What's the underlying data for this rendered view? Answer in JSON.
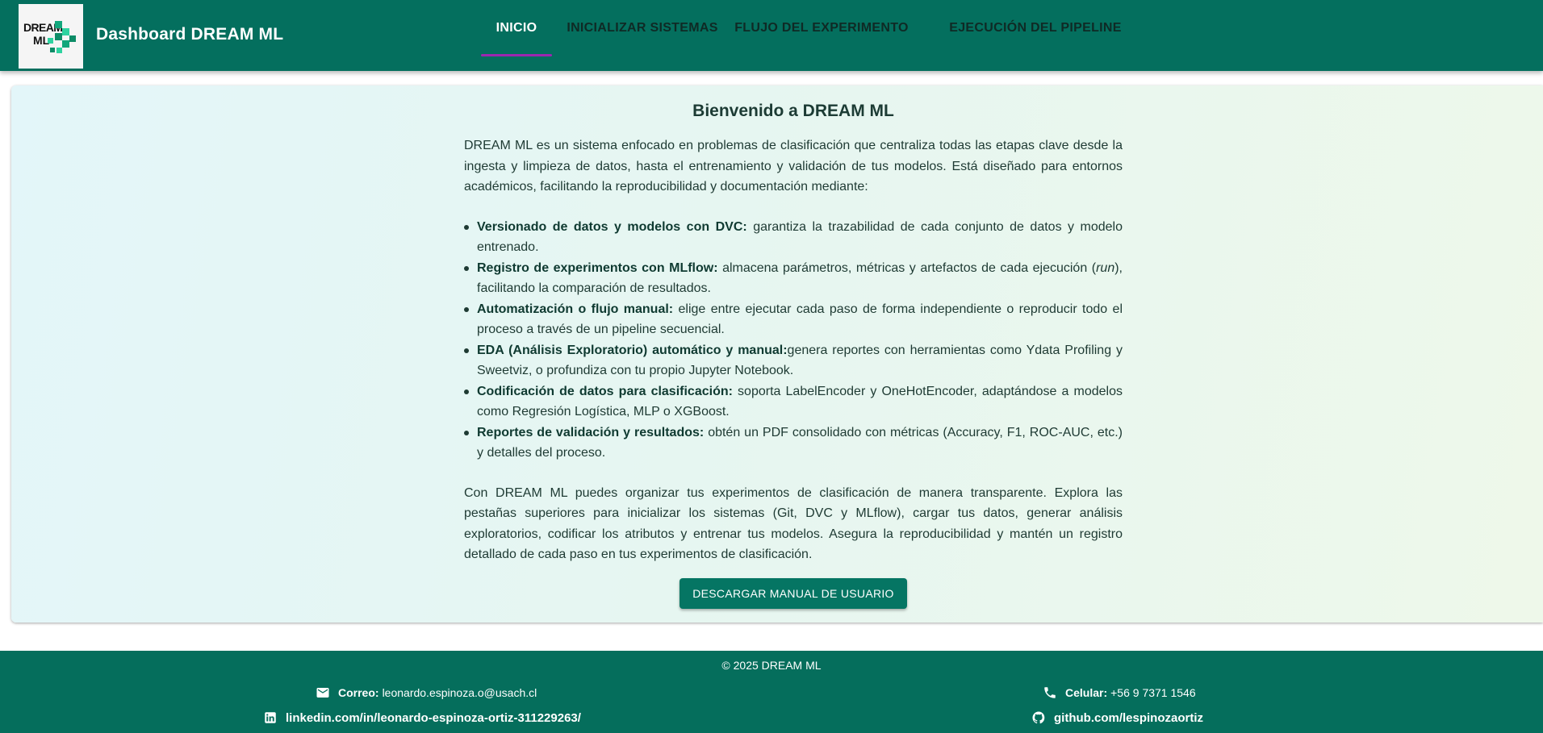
{
  "header": {
    "title": "Dashboard DREAM ML",
    "logo_text_line1": "DREAM",
    "logo_text_line2": "ML",
    "tabs": [
      {
        "label": "INICIO",
        "active": true
      },
      {
        "label": "INICIALIZAR SISTEMAS",
        "active": false
      },
      {
        "label": "FLUJO DEL EXPERIMENTO",
        "active": false
      },
      {
        "label": "EJECUCIÓN DEL PIPELINE",
        "active": false
      }
    ]
  },
  "main": {
    "welcome": "Bienvenido a DREAM ML",
    "intro": "DREAM ML es un sistema enfocado en problemas de clasificación que centraliza todas las etapas clave desde la ingesta y limpieza de datos, hasta el entrenamiento y validación de tus modelos. Está diseñado para entornos académicos, facilitando la reproducibilidad y documentación mediante:",
    "features": [
      {
        "title": "Versionado de datos y modelos con DVC:",
        "text": " garantiza la trazabilidad de cada conjunto de datos y modelo entrenado."
      },
      {
        "title": "Registro de experimentos con MLflow:",
        "text_before": " almacena parámetros, métricas y artefactos de cada ejecución (",
        "italic": "run",
        "text_after": "), facilitando la comparación de resultados."
      },
      {
        "title": "Automatización o flujo manual:",
        "text": " elige entre ejecutar cada paso de forma independiente o reproducir todo el proceso a través de un pipeline secuencial."
      },
      {
        "title": "EDA (Análisis Exploratorio) automático y manual:",
        "text": "genera reportes con herramientas como Ydata Profiling y Sweetviz, o profundiza con tu propio Jupyter Notebook."
      },
      {
        "title": "Codificación de datos para clasificación:",
        "text": " soporta LabelEncoder y OneHotEncoder, adaptándose a modelos como Regresión Logística, MLP o XGBoost."
      },
      {
        "title": "Reportes de validación y resultados:",
        "text": " obtén un PDF consolidado con métricas (Accuracy, F1, ROC-AUC, etc.) y detalles del proceso."
      }
    ],
    "outro": "Con DREAM ML puedes organizar tus experimentos de clasificación de manera transparente. Explora las pestañas superiores para inicializar los sistemas (Git, DVC y MLflow), cargar tus datos, generar análisis exploratorios, codificar los atributos y entrenar tus modelos. Asegura la reproducibilidad y mantén un registro detallado de cada paso en tus experimentos de clasificación.",
    "download_button": "DESCARGAR MANUAL DE USUARIO"
  },
  "footer": {
    "copyright": "© 2025 DREAM ML",
    "email_label": "Correo:",
    "email": "leonardo.espinoza.o@usach.cl",
    "phone_label": "Celular:",
    "phone": "+56 9 7371 1546",
    "linkedin": "linkedin.com/in/leonardo-espinoza-ortiz-311229263/",
    "github": "github.com/lespinozaortiz"
  },
  "colors": {
    "header_bg": "#046f5e",
    "footer_bg": "#056e5c",
    "button_bg": "#057563",
    "active_tab_underline": "#9c27b0"
  }
}
